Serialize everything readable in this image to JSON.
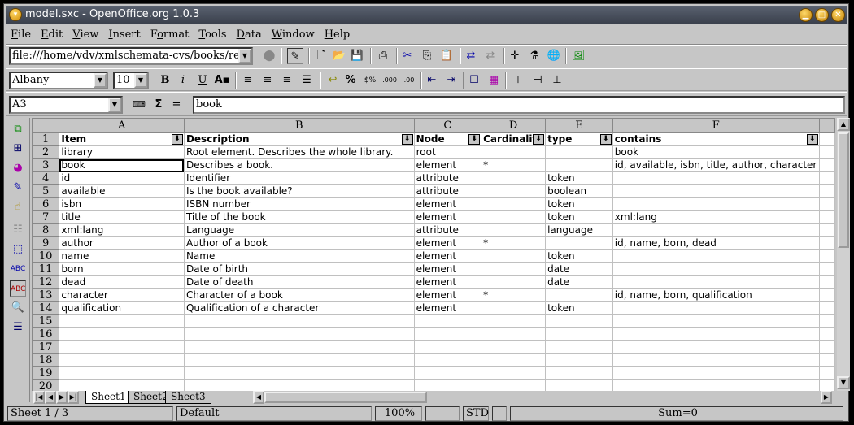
{
  "window": {
    "title": "model.sxc - OpenOffice.org 1.0.3"
  },
  "menu": [
    "File",
    "Edit",
    "View",
    "Insert",
    "Format",
    "Tools",
    "Data",
    "Window",
    "Help"
  ],
  "menu_mnemonics": [
    "F",
    "E",
    "V",
    "I",
    "o",
    "T",
    "D",
    "W",
    "H"
  ],
  "function_bar": {
    "url": "file:///home/vdv/xmlschemata-cvs/books/relaxn"
  },
  "object_bar": {
    "font_name": "Albany",
    "font_size": "10"
  },
  "formula_bar": {
    "cell_ref": "A3",
    "content": "book",
    "sum_symbol": "Σ",
    "equals_symbol": "="
  },
  "sheet": {
    "columns": [
      "A",
      "B",
      "C",
      "D",
      "E",
      "F"
    ],
    "headers": [
      "Item",
      "Description",
      "Node",
      "Cardinality",
      "type",
      "contains"
    ],
    "rows": [
      [
        "library",
        "Root element. Describes the whole library.",
        "root",
        "",
        "",
        "book"
      ],
      [
        "book",
        "Describes a book.",
        "element",
        "*",
        "",
        "id, available, isbn, title, author, character"
      ],
      [
        "id",
        "Identifier",
        "attribute",
        "",
        "token",
        ""
      ],
      [
        "available",
        "Is the book available?",
        "attribute",
        "",
        "boolean",
        ""
      ],
      [
        "isbn",
        "ISBN number",
        "element",
        "",
        "token",
        ""
      ],
      [
        "title",
        "Title of the book",
        "element",
        "",
        "token",
        "xml:lang"
      ],
      [
        "xml:lang",
        "Language",
        "attribute",
        "",
        "language",
        ""
      ],
      [
        "author",
        "Author of a book",
        "element",
        "*",
        "",
        "id, name, born, dead"
      ],
      [
        "name",
        "Name",
        "element",
        "",
        "token",
        ""
      ],
      [
        "born",
        "Date of birth",
        "element",
        "",
        "date",
        ""
      ],
      [
        "dead",
        "Date of death",
        "element",
        "",
        "date",
        ""
      ],
      [
        "character",
        "Character of a book",
        "element",
        "*",
        "",
        "id, name, born, qualification"
      ],
      [
        "qualification",
        "Qualification of a character",
        "element",
        "",
        "token",
        ""
      ]
    ],
    "row_numbers": [
      "1",
      "2",
      "3",
      "4",
      "5",
      "6",
      "7",
      "8",
      "9",
      "10",
      "11",
      "12",
      "13",
      "14",
      "15",
      "16",
      "17",
      "18",
      "19",
      "20"
    ],
    "selected_cell": "A3"
  },
  "tabs": [
    "Sheet1",
    "Sheet2",
    "Sheet3"
  ],
  "status": {
    "sheet": "Sheet 1 / 3",
    "style": "Default",
    "zoom": "100%",
    "mode": "STD",
    "sum": "Sum=0"
  }
}
